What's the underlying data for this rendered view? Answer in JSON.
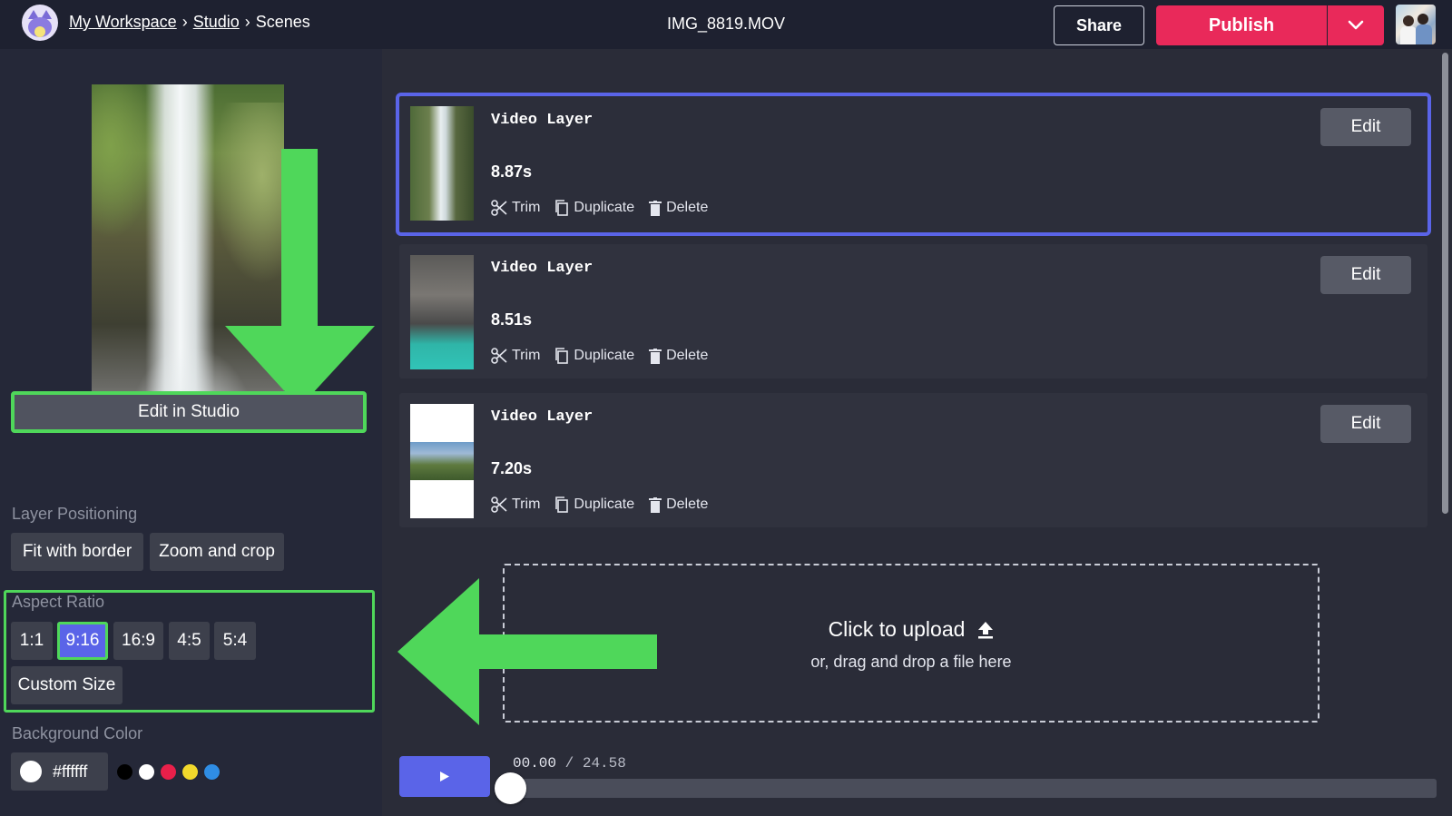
{
  "header": {
    "breadcrumb": {
      "workspace": "My Workspace",
      "studio": "Studio",
      "current": "Scenes",
      "separator": "›"
    },
    "filename": "IMG_8819.MOV",
    "share_label": "Share",
    "publish_label": "Publish"
  },
  "left_panel": {
    "edit_in_studio_label": "Edit in Studio",
    "layer_positioning": {
      "label": "Layer Positioning",
      "options": [
        "Fit with border",
        "Zoom and crop"
      ]
    },
    "aspect_ratio": {
      "label": "Aspect Ratio",
      "options": [
        "1:1",
        "9:16",
        "16:9",
        "4:5",
        "5:4"
      ],
      "selected": "9:16",
      "custom_label": "Custom Size"
    },
    "background_color": {
      "label": "Background Color",
      "value": "#ffffff",
      "swatches": [
        "#000000",
        "#ffffff",
        "#e9204a",
        "#f2d92c",
        "#2f8de4"
      ]
    }
  },
  "layers": [
    {
      "title": "Video Layer",
      "duration": "8.87s",
      "active": true
    },
    {
      "title": "Video Layer",
      "duration": "8.51s",
      "active": false
    },
    {
      "title": "Video Layer",
      "duration": "7.20s",
      "active": false
    }
  ],
  "layer_actions": {
    "trim": "Trim",
    "duplicate": "Duplicate",
    "delete": "Delete",
    "edit": "Edit"
  },
  "upload": {
    "title": "Click to upload",
    "subtitle": "or, drag and drop a file here"
  },
  "player": {
    "current_time": "00.00",
    "separator": "/",
    "total_time": "24.58",
    "progress": 0
  },
  "colors": {
    "accent": "#5a64e8",
    "publish": "#e9295a",
    "annotation_green": "#4fd75a",
    "bg_dark": "#1e2130"
  }
}
